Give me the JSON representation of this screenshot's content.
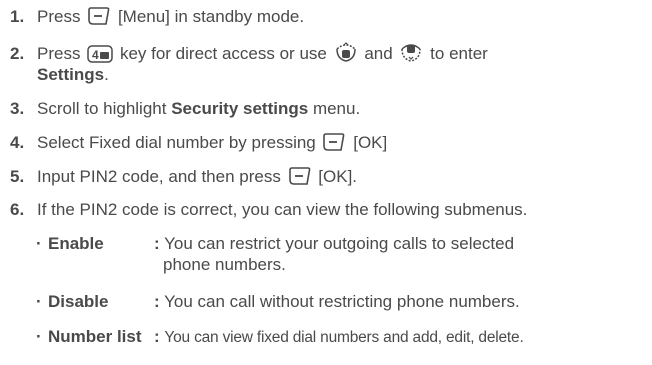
{
  "steps": [
    {
      "num": "1.",
      "before": "Press",
      "icon": "left-soft-key-icon",
      "after": "[Menu] in standby mode."
    },
    {
      "num": "2.",
      "before": "Press",
      "icon": "key-4-icon",
      "mid1": "key for direct access or use",
      "icon2": "navigation-key-down-icon",
      "mid2": "and",
      "icon3": "navigation-key-up-icon",
      "mid3": "to enter",
      "bold": "Settings",
      "end": "."
    },
    {
      "num": "3.",
      "before": "Scroll to highlight",
      "bold": "Security settings",
      "after": "menu."
    },
    {
      "num": "4.",
      "before": "Select Fixed dial number by pressing",
      "icon": "left-soft-key-icon",
      "after": "[OK]"
    },
    {
      "num": "5.",
      "before": "Input PIN2 code, and then press",
      "icon": "left-soft-key-icon",
      "after": "[OK]."
    },
    {
      "num": "6.",
      "text": "If the PIN2 code is correct, you can view the following submenus."
    }
  ],
  "submenus": [
    {
      "bullet": "·",
      "term": "Enable",
      "colon": ":",
      "desc": "You can restrict your outgoing calls to selected",
      "desc2": "phone numbers."
    },
    {
      "bullet": "·",
      "term": "Disable",
      "colon": ":",
      "desc": "You can call without restricting phone numbers."
    },
    {
      "bullet": "·",
      "term": "Number list",
      "colon": ":",
      "desc": "You can view fixed dial numbers and add, edit, delete."
    }
  ]
}
